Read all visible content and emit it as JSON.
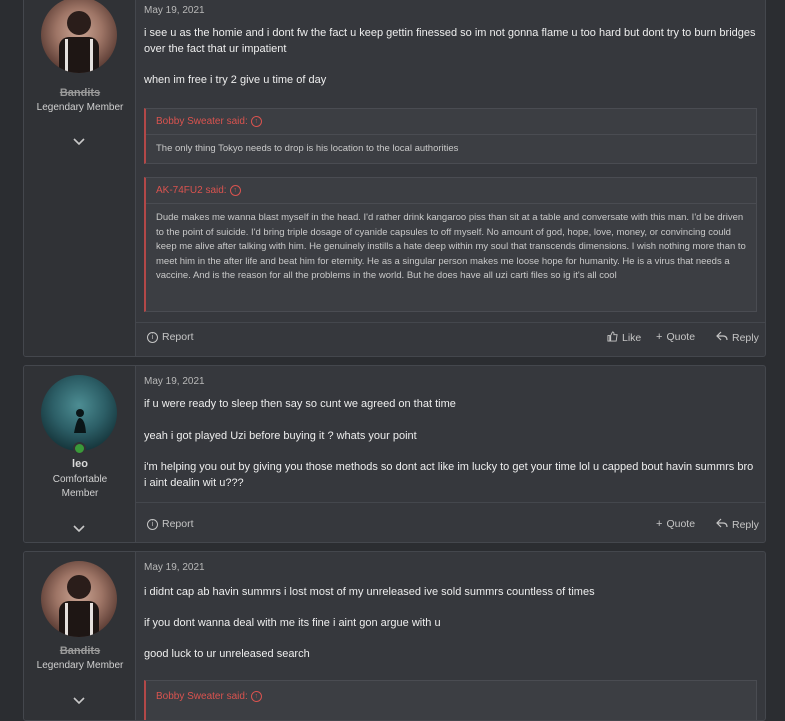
{
  "posts": [
    {
      "username": "Bandits",
      "user_title": "Legendary Member",
      "date": "May 19, 2021",
      "paragraphs": [
        "i see u as the homie and i dont fw the fact u keep gettin finessed so im not gonna flame u too hard but dont try to burn bridges over the fact that ur impatient",
        "when im free i try 2 give u time of day"
      ],
      "quotes": [
        {
          "author_said": "Bobby Sweater said:",
          "text": "The only thing Tokyo needs to drop is his location to the local authorities"
        },
        {
          "author_said": "AK-74FU2 said:",
          "text": "Dude makes me wanna blast myself in the head. I'd rather drink kangaroo piss than sit at a table and conversate with this man. I'd be driven to the point of suicide. I'd bring triple dosage of cyanide capsules to off myself. No amount of god, hope, love, money, or convincing could keep me alive after talking with him. He genuinely instills a hate deep within my soul that transcends dimensions. I wish nothing more than to meet him in the after life and beat him for eternity. He as a singular person makes me loose hope for humanity. He is a virus that needs a vaccine. And is the reason for all the problems in the world. But he does have all uzi carti files so ig it's all cool"
        }
      ],
      "actions": {
        "report": "Report",
        "like": "Like",
        "quote": "Quote",
        "reply": "Reply"
      }
    },
    {
      "username": "leo",
      "user_title_line1": "Comfortable",
      "user_title_line2": "Member",
      "date": "May 19, 2021",
      "paragraphs": [
        "if u were ready to sleep then say so cunt we agreed on that time",
        "yeah i got played Uzi before buying it ? whats your point",
        "i'm helping you out by giving you those methods so dont act like im lucky to get your time lol u capped bout havin summrs bro i aint dealin wit u???"
      ],
      "actions": {
        "report": "Report",
        "quote": "Quote",
        "reply": "Reply"
      }
    },
    {
      "username": "Bandits",
      "user_title": "Legendary Member",
      "date": "May 19, 2021",
      "paragraphs": [
        "i didnt cap ab havin summrs i lost most of my unreleased ive sold summrs countless of times",
        "if you dont wanna deal with me its fine i aint gon argue with u",
        "good luck to ur unreleased search"
      ],
      "quotes": [
        {
          "author_said": "Bobby Sweater said:"
        }
      ]
    }
  ],
  "icons": {
    "expand": "chevron-down",
    "report": "info-circle",
    "like": "thumbs-up",
    "quote": "plus",
    "reply": "reply-arrow",
    "quote_jump": "arrow-up-circle"
  },
  "colors": {
    "page_bg": "#2b2d31",
    "post_bg": "#36383d",
    "user_col_bg": "#303236",
    "quote_accent": "#d9534f",
    "online": "#3a9a39"
  }
}
